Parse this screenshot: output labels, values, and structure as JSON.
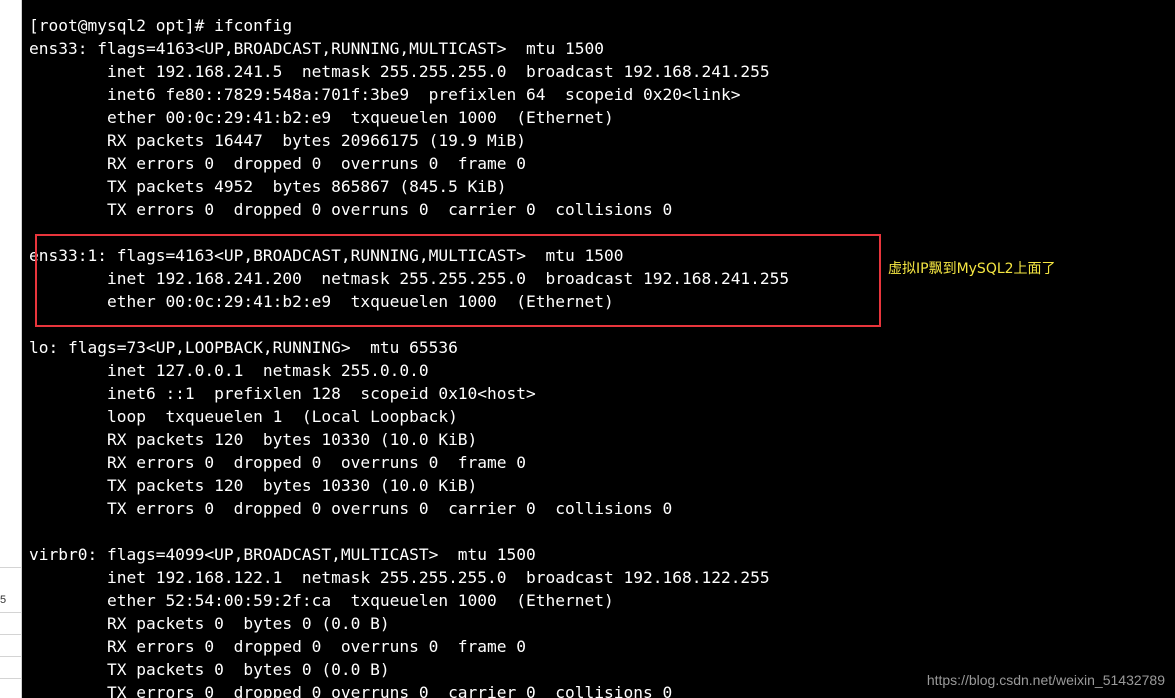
{
  "terminal": {
    "lines": [
      "[root@mysql2 opt]# ifconfig",
      "ens33: flags=4163<UP,BROADCAST,RUNNING,MULTICAST>  mtu 1500",
      "        inet 192.168.241.5  netmask 255.255.255.0  broadcast 192.168.241.255",
      "        inet6 fe80::7829:548a:701f:3be9  prefixlen 64  scopeid 0x20<link>",
      "        ether 00:0c:29:41:b2:e9  txqueuelen 1000  (Ethernet)",
      "        RX packets 16447  bytes 20966175 (19.9 MiB)",
      "        RX errors 0  dropped 0  overruns 0  frame 0",
      "        TX packets 4952  bytes 865867 (845.5 KiB)",
      "        TX errors 0  dropped 0 overruns 0  carrier 0  collisions 0",
      "",
      "ens33:1: flags=4163<UP,BROADCAST,RUNNING,MULTICAST>  mtu 1500",
      "        inet 192.168.241.200  netmask 255.255.255.0  broadcast 192.168.241.255",
      "        ether 00:0c:29:41:b2:e9  txqueuelen 1000  (Ethernet)",
      "",
      "lo: flags=73<UP,LOOPBACK,RUNNING>  mtu 65536",
      "        inet 127.0.0.1  netmask 255.0.0.0",
      "        inet6 ::1  prefixlen 128  scopeid 0x10<host>",
      "        loop  txqueuelen 1  (Local Loopback)",
      "        RX packets 120  bytes 10330 (10.0 KiB)",
      "        RX errors 0  dropped 0  overruns 0  frame 0",
      "        TX packets 120  bytes 10330 (10.0 KiB)",
      "        TX errors 0  dropped 0 overruns 0  carrier 0  collisions 0",
      "",
      "virbr0: flags=4099<UP,BROADCAST,MULTICAST>  mtu 1500",
      "        inet 192.168.122.1  netmask 255.255.255.0  broadcast 192.168.122.255",
      "        ether 52:54:00:59:2f:ca  txqueuelen 1000  (Ethernet)",
      "        RX packets 0  bytes 0 (0.0 B)",
      "        RX errors 0  dropped 0  overruns 0  frame 0",
      "        TX packets 0  bytes 0 (0.0 B)",
      "        TX errors 0  dropped 0 overruns 0  carrier 0  collisions 0"
    ]
  },
  "annotation": {
    "text": "虚拟IP飘到MySQL2上面了",
    "text_color": "#f5e642",
    "box_color": "#e8353c"
  },
  "watermark": {
    "text": "https://blog.csdn.net/weixin_51432789"
  },
  "left_strip": {
    "number": "5"
  },
  "colors": {
    "terminal_background": "#000000",
    "terminal_text": "#ffffff"
  }
}
